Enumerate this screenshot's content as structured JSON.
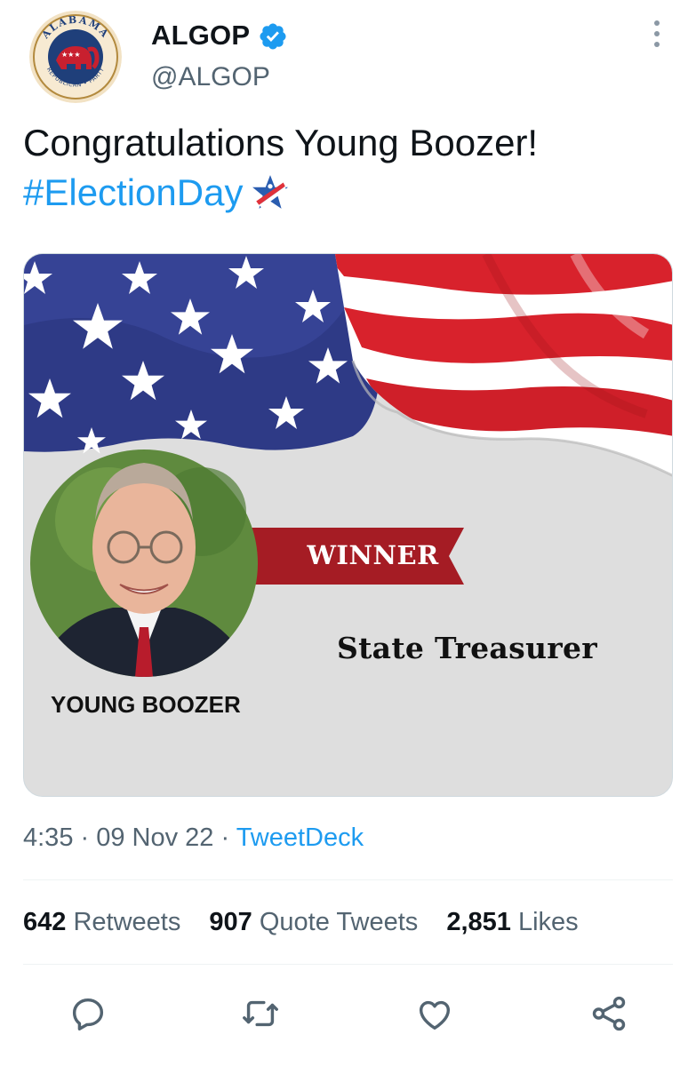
{
  "tweet": {
    "display_name": "ALGOP",
    "handle": "@ALGOP",
    "verified": true,
    "text_line1": "Congratulations Young Boozer!",
    "hashtag": "#ElectionDay",
    "avatar_logo_text_top": "ALABAMA",
    "avatar_logo_text_bottom": "REPUBLICAN • PARTY",
    "time": "4:35",
    "date": "09 Nov 22",
    "source": "TweetDeck",
    "sep": " · "
  },
  "media": {
    "banner_label": "WINNER",
    "office": "State Treasurer",
    "candidate": "YOUNG BOOZER"
  },
  "stats": {
    "retweets_count": "642",
    "retweets_label": "Retweets",
    "quotes_count": "907",
    "quotes_label": "Quote Tweets",
    "likes_count": "2,851",
    "likes_label": "Likes"
  },
  "colors": {
    "link": "#1d9bf0",
    "secondary_text": "#536471",
    "banner_red": "#a51c24",
    "flag_blue": "#2f3c8c",
    "flag_red": "#d6202b"
  },
  "icons": [
    "verified-badge-icon",
    "more-options-icon",
    "star-emoji-icon",
    "reply-icon",
    "retweet-icon",
    "like-icon",
    "share-icon"
  ]
}
